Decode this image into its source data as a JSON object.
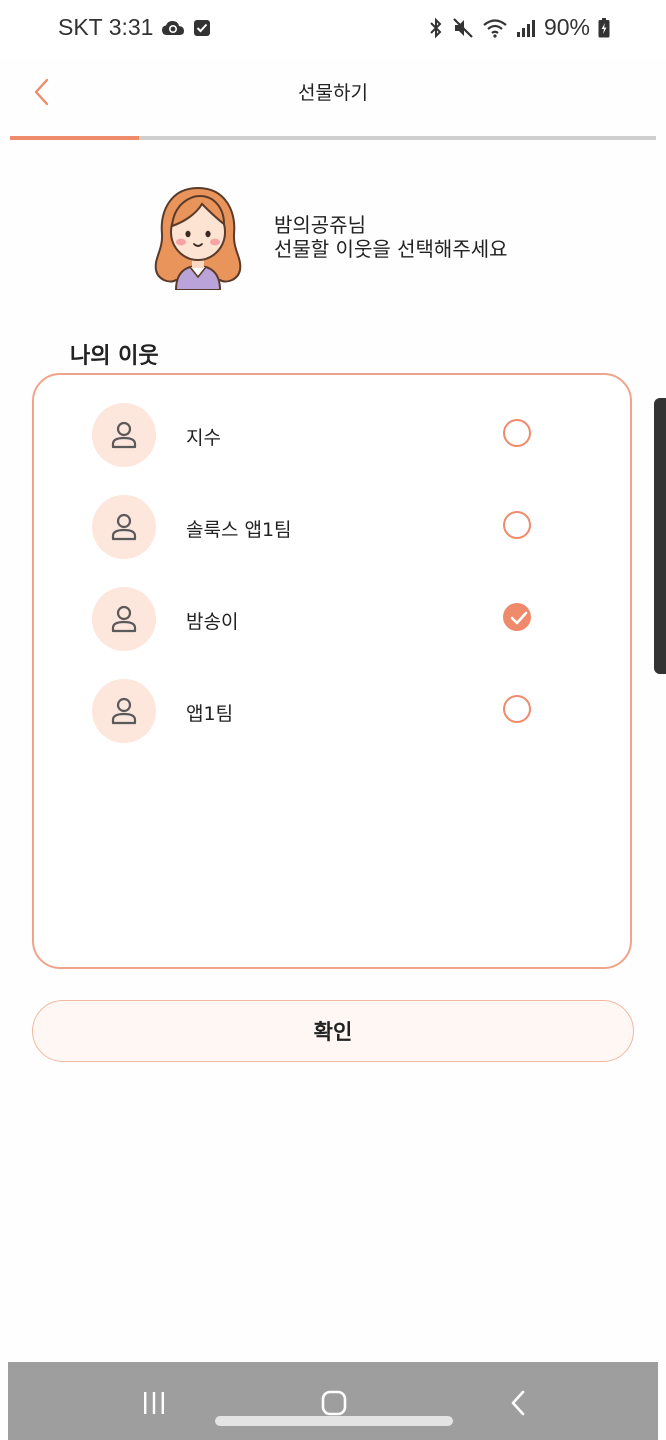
{
  "status_bar": {
    "carrier_time": "SKT 3:31",
    "battery": "90%"
  },
  "header": {
    "title": "선물하기",
    "progress": 0.2
  },
  "intro": {
    "line1": "밤의공쥬님",
    "line2": "선물할 이웃을 선택해주세요"
  },
  "neighbors": {
    "section_title": "나의 이웃",
    "items": [
      {
        "name": "지수",
        "selected": false
      },
      {
        "name": "솔룩스 앱1팀",
        "selected": false
      },
      {
        "name": "밤송이",
        "selected": true
      },
      {
        "name": "앱1팀",
        "selected": false
      }
    ]
  },
  "confirm_button": {
    "label": "확인"
  },
  "colors": {
    "accent": "#ef8a6b",
    "avatar_bg": "#fde6dc",
    "button_bg": "#fff7f3"
  },
  "icons": {
    "back": "chevron-left-icon",
    "user": "user-icon",
    "check": "check-icon"
  }
}
